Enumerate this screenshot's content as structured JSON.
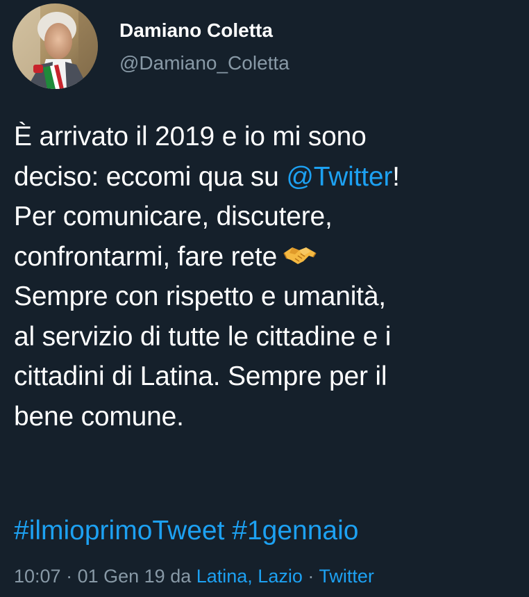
{
  "author": {
    "display_name": "Damiano Coletta",
    "handle": "@Damiano_Coletta",
    "avatar_icon": "profile-photo"
  },
  "tweet": {
    "lines": [
      [
        "È arrivato il 2019 e io mi sono"
      ],
      [
        "deciso: eccomi qua su ",
        "@Twitter",
        "!"
      ],
      [
        "Per comunicare, discutere,"
      ],
      [
        "confrontarmi, fare rete"
      ],
      [
        "Sempre con rispetto e umanità,"
      ],
      [
        "al servizio di tutte le cittadine e i"
      ],
      [
        "cittadini di Latina. Sempre per il"
      ],
      [
        "bene comune."
      ]
    ],
    "handshake_emoji_icon": "handshake-icon",
    "hashtags": [
      "#ilmioprimoTweet",
      "#1gennaio"
    ]
  },
  "meta": {
    "time": "10:07",
    "separator1": " · ",
    "date": "01 Gen 19",
    "da": " da ",
    "location": "Latina, Lazio",
    "separator2": " · ",
    "source": "Twitter"
  },
  "colors": {
    "background": "#15202b",
    "text": "#ffffff",
    "secondary": "#8899a6",
    "link": "#1da1f2"
  }
}
